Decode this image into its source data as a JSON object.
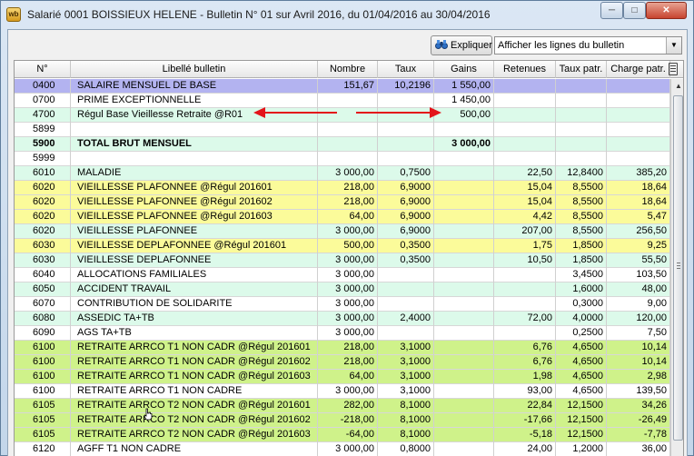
{
  "window": {
    "title": "Salarié 0001 BOISSIEUX HELENE - Bulletin N° 01 sur Avril 2016, du 01/04/2016 au 30/04/2016",
    "app_icon": "wb",
    "min_label": "─",
    "max_label": "□",
    "close_label": "✕"
  },
  "toolbar": {
    "explain_label": "Expliquer",
    "explain_icon": "binoculars-icon",
    "select_value": "Afficher les lignes du bulletin",
    "select_arrow": "▼"
  },
  "columns": [
    "N°",
    "Libellé bulletin",
    "Nombre",
    "Taux",
    "Gains",
    "Retenues",
    "Taux patr.",
    "Charge patr."
  ],
  "colors": {
    "selected": "#b3b3f0",
    "mint": "#dcfaea",
    "yellow": "#fbfb9a",
    "lime": "#cff28a",
    "white": "#ffffff",
    "arrow": "#e3141a"
  },
  "rows": [
    {
      "num": "0400",
      "lib": "SALAIRE MENSUEL DE BASE",
      "nb": "151,67",
      "taux": "10,2196",
      "gains": "1 550,00",
      "ret": "",
      "tp": "",
      "cp": "",
      "style": "selected"
    },
    {
      "num": "0700",
      "lib": "PRIME EXCEPTIONNELLE",
      "nb": "",
      "taux": "",
      "gains": "1 450,00",
      "ret": "",
      "tp": "",
      "cp": "",
      "style": "white"
    },
    {
      "num": "4700",
      "lib": "Régul Base Vieillesse Retraite @R01",
      "nb": "",
      "taux": "",
      "gains": "500,00",
      "ret": "",
      "tp": "",
      "cp": "",
      "style": "mint"
    },
    {
      "num": "5899",
      "lib": "",
      "nb": "",
      "taux": "",
      "gains": "",
      "ret": "",
      "tp": "",
      "cp": "",
      "style": "white"
    },
    {
      "num": "5900",
      "lib": "TOTAL BRUT MENSUEL",
      "nb": "",
      "taux": "",
      "gains": "3 000,00",
      "ret": "",
      "tp": "",
      "cp": "",
      "style": "mint",
      "bold": true
    },
    {
      "num": "5999",
      "lib": "",
      "nb": "",
      "taux": "",
      "gains": "",
      "ret": "",
      "tp": "",
      "cp": "",
      "style": "white"
    },
    {
      "num": "6010",
      "lib": "MALADIE",
      "nb": "3 000,00",
      "taux": "0,7500",
      "gains": "",
      "ret": "22,50",
      "tp": "12,8400",
      "cp": "385,20",
      "style": "mint"
    },
    {
      "num": "6020",
      "lib": "VIEILLESSE PLAFONNEE @Régul 201601",
      "nb": "218,00",
      "taux": "6,9000",
      "gains": "",
      "ret": "15,04",
      "tp": "8,5500",
      "cp": "18,64",
      "style": "yellow"
    },
    {
      "num": "6020",
      "lib": "VIEILLESSE PLAFONNEE @Régul 201602",
      "nb": "218,00",
      "taux": "6,9000",
      "gains": "",
      "ret": "15,04",
      "tp": "8,5500",
      "cp": "18,64",
      "style": "yellow"
    },
    {
      "num": "6020",
      "lib": "VIEILLESSE PLAFONNEE @Régul 201603",
      "nb": "64,00",
      "taux": "6,9000",
      "gains": "",
      "ret": "4,42",
      "tp": "8,5500",
      "cp": "5,47",
      "style": "yellow"
    },
    {
      "num": "6020",
      "lib": "VIEILLESSE PLAFONNEE",
      "nb": "3 000,00",
      "taux": "6,9000",
      "gains": "",
      "ret": "207,00",
      "tp": "8,5500",
      "cp": "256,50",
      "style": "mint"
    },
    {
      "num": "6030",
      "lib": "VIEILLESSE DEPLAFONNEE @Régul 201601",
      "nb": "500,00",
      "taux": "0,3500",
      "gains": "",
      "ret": "1,75",
      "tp": "1,8500",
      "cp": "9,25",
      "style": "yellow"
    },
    {
      "num": "6030",
      "lib": "VIEILLESSE DEPLAFONNEE",
      "nb": "3 000,00",
      "taux": "0,3500",
      "gains": "",
      "ret": "10,50",
      "tp": "1,8500",
      "cp": "55,50",
      "style": "mint"
    },
    {
      "num": "6040",
      "lib": "ALLOCATIONS FAMILIALES",
      "nb": "3 000,00",
      "taux": "",
      "gains": "",
      "ret": "",
      "tp": "3,4500",
      "cp": "103,50",
      "style": "white"
    },
    {
      "num": "6050",
      "lib": "ACCIDENT TRAVAIL",
      "nb": "3 000,00",
      "taux": "",
      "gains": "",
      "ret": "",
      "tp": "1,6000",
      "cp": "48,00",
      "style": "mint"
    },
    {
      "num": "6070",
      "lib": "CONTRIBUTION DE SOLIDARITE",
      "nb": "3 000,00",
      "taux": "",
      "gains": "",
      "ret": "",
      "tp": "0,3000",
      "cp": "9,00",
      "style": "white"
    },
    {
      "num": "6080",
      "lib": "ASSEDIC TA+TB",
      "nb": "3 000,00",
      "taux": "2,4000",
      "gains": "",
      "ret": "72,00",
      "tp": "4,0000",
      "cp": "120,00",
      "style": "mint"
    },
    {
      "num": "6090",
      "lib": "AGS TA+TB",
      "nb": "3 000,00",
      "taux": "",
      "gains": "",
      "ret": "",
      "tp": "0,2500",
      "cp": "7,50",
      "style": "white"
    },
    {
      "num": "6100",
      "lib": "RETRAITE ARRCO T1 NON CADR @Régul 201601",
      "nb": "218,00",
      "taux": "3,1000",
      "gains": "",
      "ret": "6,76",
      "tp": "4,6500",
      "cp": "10,14",
      "style": "lime"
    },
    {
      "num": "6100",
      "lib": "RETRAITE ARRCO T1 NON CADR @Régul 201602",
      "nb": "218,00",
      "taux": "3,1000",
      "gains": "",
      "ret": "6,76",
      "tp": "4,6500",
      "cp": "10,14",
      "style": "lime"
    },
    {
      "num": "6100",
      "lib": "RETRAITE ARRCO T1 NON CADR @Régul 201603",
      "nb": "64,00",
      "taux": "3,1000",
      "gains": "",
      "ret": "1,98",
      "tp": "4,6500",
      "cp": "2,98",
      "style": "lime"
    },
    {
      "num": "6100",
      "lib": "RETRAITE ARRCO T1 NON CADRE",
      "nb": "3 000,00",
      "taux": "3,1000",
      "gains": "",
      "ret": "93,00",
      "tp": "4,6500",
      "cp": "139,50",
      "style": "white"
    },
    {
      "num": "6105",
      "lib": "RETRAITE ARRCO T2 NON CADR @Régul 201601",
      "nb": "282,00",
      "taux": "8,1000",
      "gains": "",
      "ret": "22,84",
      "tp": "12,1500",
      "cp": "34,26",
      "style": "lime"
    },
    {
      "num": "6105",
      "lib": "RETRAITE ARRCO T2 NON CADR @Régul 201602",
      "nb": "-218,00",
      "taux": "8,1000",
      "gains": "",
      "ret": "-17,66",
      "tp": "12,1500",
      "cp": "-26,49",
      "style": "lime"
    },
    {
      "num": "6105",
      "lib": "RETRAITE ARRCO T2 NON CADR @Régul 201603",
      "nb": "-64,00",
      "taux": "8,1000",
      "gains": "",
      "ret": "-5,18",
      "tp": "12,1500",
      "cp": "-7,78",
      "style": "lime"
    },
    {
      "num": "6120",
      "lib": "AGFF T1 NON CADRE",
      "nb": "3 000,00",
      "taux": "0,8000",
      "gains": "",
      "ret": "24,00",
      "tp": "1,2000",
      "cp": "36,00",
      "style": "white"
    }
  ]
}
